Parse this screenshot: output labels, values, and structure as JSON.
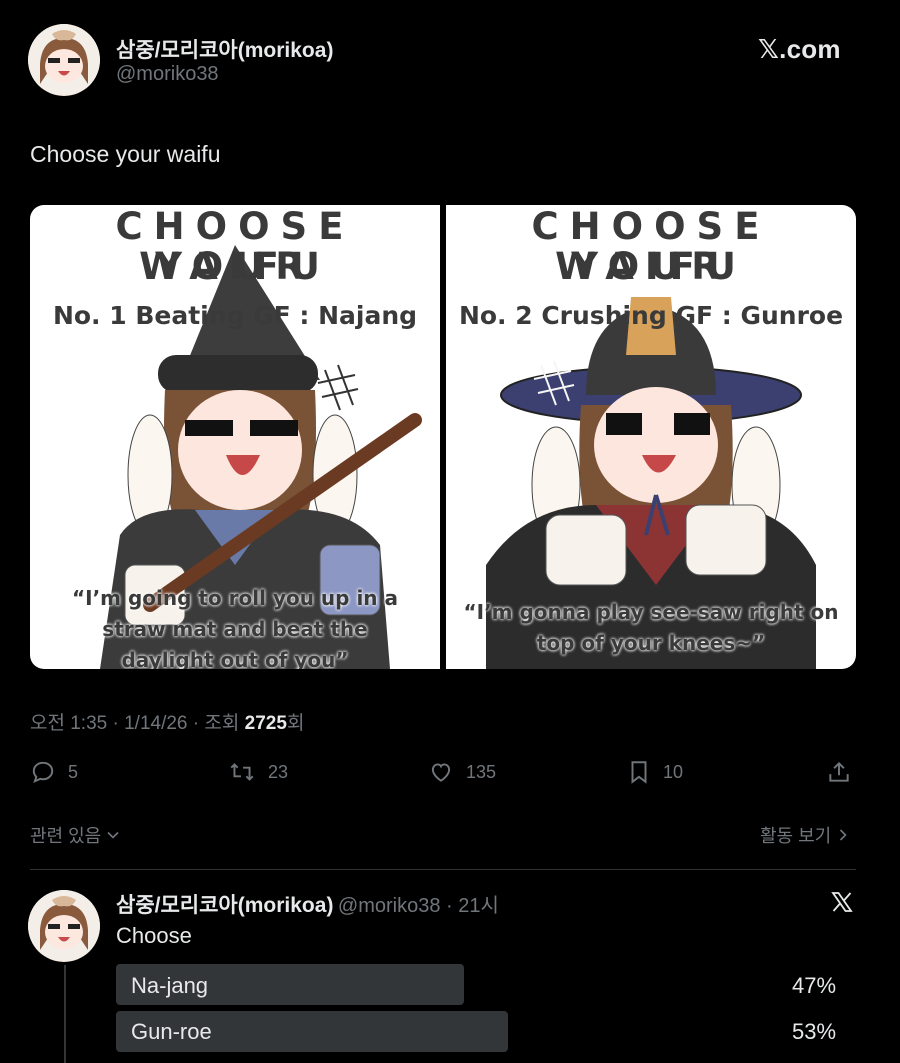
{
  "header": {
    "display_name": "삼중/모리코아(morikoa)",
    "handle": "@moriko38",
    "site_label": "𝕏.com"
  },
  "tweet": {
    "text": "Choose your waifu",
    "media": {
      "left": {
        "title": "CHOOSE YOUR",
        "title2": "WAIFU",
        "subtitle": "No. 1 Beating GF : Najang",
        "quote_l1": "“I’m going to roll you up in a",
        "quote_l2": "straw mat and beat the",
        "quote_l3": "daylight out of you”"
      },
      "right": {
        "title": "CHOOSE YOUR",
        "title2": "WAIFU",
        "subtitle": "No. 2 Crushing GF : Gunroe",
        "quote_l1": "“I’m gonna play see-saw right on",
        "quote_l2": "top of your knees~”"
      }
    },
    "meta": {
      "time": "오전 1:35",
      "sep1": " · ",
      "date": "1/14/26",
      "sep2": " · ",
      "views_prefix": "조회 ",
      "views": "2725",
      "views_suffix": "회"
    },
    "actions": {
      "replies": "5",
      "retweets": "23",
      "likes": "135",
      "bookmarks": "10"
    },
    "related_label": "관련 있음",
    "activity_label": "활동 보기"
  },
  "reply": {
    "display_name": "삼중/모리코아(morikoa)",
    "handle": "@moriko38",
    "sep": " · ",
    "time": "21시",
    "text": "Choose",
    "poll": [
      {
        "label": "Na-jang",
        "percent_text": "47%",
        "fraction": 0.47
      },
      {
        "label": "Gun-roe",
        "percent_text": "53%",
        "fraction": 0.53
      }
    ]
  },
  "colors": {
    "background": "#000000",
    "text_primary": "#e7e9ea",
    "text_secondary": "#71767b",
    "poll_bar": "#333639"
  },
  "icons": [
    "avatar",
    "x-logo-icon",
    "reply-icon",
    "retweet-icon",
    "like-icon",
    "bookmark-icon",
    "share-icon",
    "chevron-down-icon",
    "chevron-right-icon"
  ]
}
